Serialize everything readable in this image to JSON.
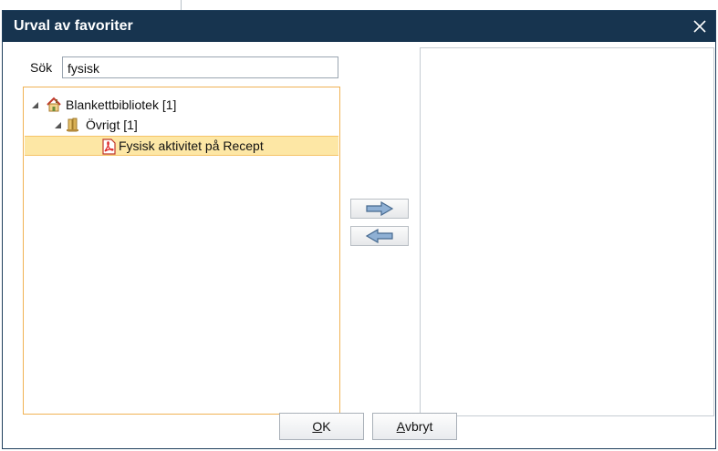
{
  "dialog": {
    "title": "Urval av favoriter",
    "close_glyph": "✕",
    "close_icon": "close-icon"
  },
  "search": {
    "label": "Sök",
    "value": "fysisk"
  },
  "tree": {
    "nodes": [
      {
        "label": "Blankettbibliotek [1]",
        "icon": "house-icon",
        "expanded": true,
        "level": 0
      },
      {
        "label": "Övrigt [1]",
        "icon": "folder-icon",
        "expanded": true,
        "level": 1
      },
      {
        "label": "Fysisk aktivitet på Recept",
        "icon": "pdf-icon",
        "selected": true,
        "level": 2
      }
    ]
  },
  "transfer": {
    "add_icon": "arrow-right-icon",
    "remove_icon": "arrow-left-icon"
  },
  "buttons": {
    "ok_accesskey": "O",
    "ok_rest": "K",
    "cancel_accesskey": "A",
    "cancel_rest": "vbryt"
  },
  "colors": {
    "title_bar": "#17344f",
    "selection": "#fde7a5",
    "tree_border": "#f0b254",
    "arrow_fill": "#6e8fb3"
  }
}
